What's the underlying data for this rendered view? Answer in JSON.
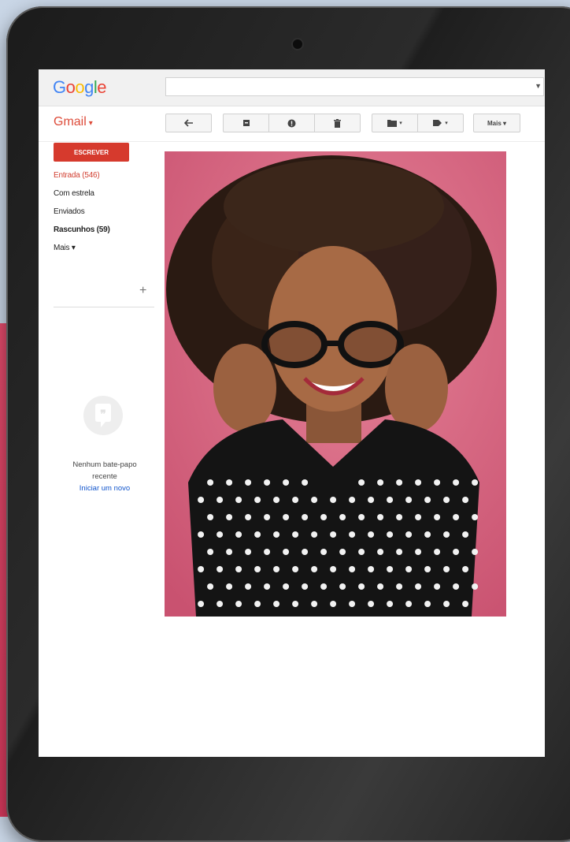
{
  "app": {
    "logo": "Google",
    "logo_colors": [
      "#4285f4",
      "#ea4335",
      "#fbbc05",
      "#4285f4",
      "#34a853",
      "#ea4335"
    ],
    "product": "Gmail",
    "product_dropdown": "▾"
  },
  "toolbar": {
    "reply_icon": "reply-icon",
    "archive_icon": "archive-icon",
    "spam_icon": "report-spam-icon",
    "delete_icon": "trash-icon",
    "move_icon": "folder-icon",
    "labels_icon": "label-icon",
    "more_label": "Mais ▾"
  },
  "sidebar": {
    "compose_label": "ESCREVER",
    "items": [
      {
        "label": "Entrada (546)",
        "state": "active"
      },
      {
        "label": "Com estrela",
        "state": "normal"
      },
      {
        "label": "Enviados",
        "state": "normal"
      },
      {
        "label": "Rascunhos (59)",
        "state": "bold"
      },
      {
        "label": "Mais ▾",
        "state": "normal"
      }
    ],
    "add_label": "+"
  },
  "chat": {
    "empty_line1": "Nenhum bate-papo",
    "empty_line2": "recente",
    "start_link": "Iniciar um novo"
  },
  "colors": {
    "accent_red": "#dd4b39",
    "compose_red": "#d63a2d",
    "link_blue": "#1155cc",
    "photo_background": "#d6627d"
  }
}
